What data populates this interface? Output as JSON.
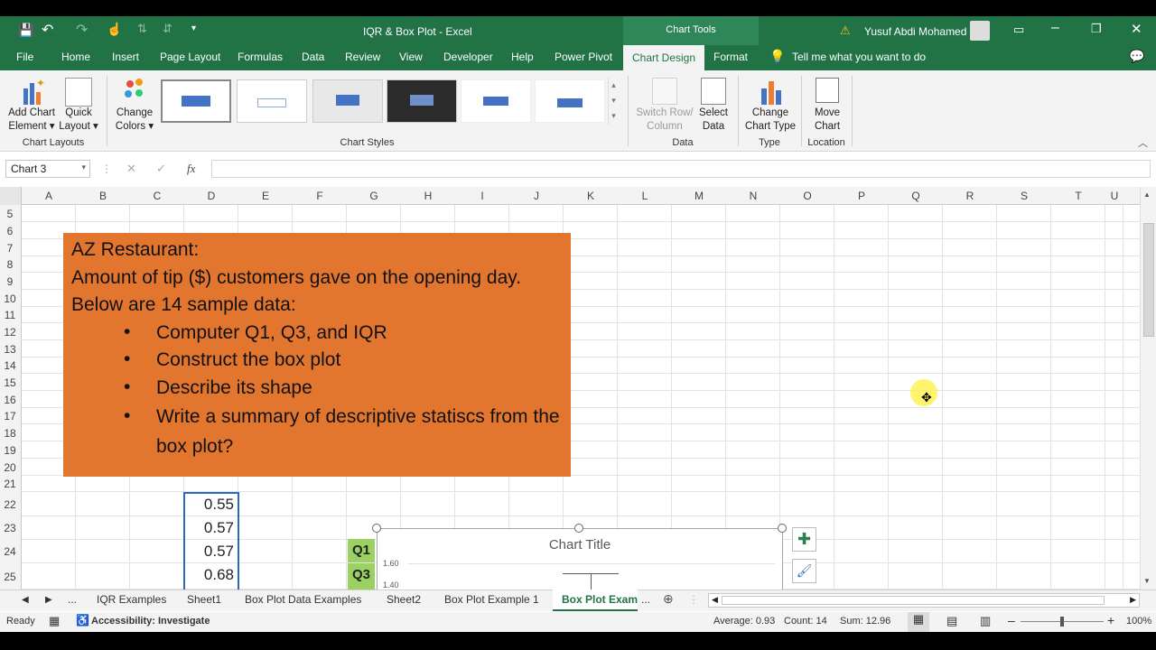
{
  "window": {
    "title": "IQR & Box Plot  -  Excel",
    "user": "Yusuf Abdi Mohamed",
    "chart_tools": "Chart Tools"
  },
  "tabs": [
    "File",
    "Home",
    "Insert",
    "Page Layout",
    "Formulas",
    "Data",
    "Review",
    "View",
    "Developer",
    "Help",
    "Power Pivot",
    "Chart Design",
    "Format"
  ],
  "tell_me": "Tell me what you want to do",
  "ribbon": {
    "add_chart_element": [
      "Add Chart",
      "Element"
    ],
    "quick_layout": [
      "Quick",
      "Layout"
    ],
    "chart_layouts": "Chart Layouts",
    "change_colors": [
      "Change",
      "Colors"
    ],
    "chart_styles": "Chart Styles",
    "switch_row_col": [
      "Switch Row/",
      "Column"
    ],
    "select_data": [
      "Select",
      "Data"
    ],
    "data_group": "Data",
    "change_chart_type": [
      "Change",
      "Chart Type"
    ],
    "type_group": "Type",
    "move_chart": [
      "Move",
      "Chart"
    ],
    "location_group": "Location"
  },
  "name_box": "Chart 3",
  "formula_buttons": {
    "cancel": "✕",
    "enter": "✓",
    "fx": "fx"
  },
  "columns": [
    "A",
    "B",
    "C",
    "D",
    "E",
    "F",
    "G",
    "H",
    "I",
    "J",
    "K",
    "L",
    "M",
    "N",
    "O",
    "P",
    "Q",
    "R",
    "S",
    "T",
    "U"
  ],
  "rows": [
    "5",
    "6",
    "7",
    "8",
    "9",
    "10",
    "11",
    "12",
    "13",
    "14",
    "15",
    "16",
    "17",
    "18",
    "19",
    "20",
    "21",
    "22",
    "23",
    "24",
    "25"
  ],
  "box": {
    "line1": "AZ Restaurant:",
    "line2": "Amount of tip ($) customers gave on the opening day.",
    "line3": "Below are 14 sample data:",
    "bullets": [
      "Computer Q1, Q3, and IQR",
      "Construct the box plot",
      "Describe its shape",
      "Write a summary of descriptive statiscs from the box plot?"
    ]
  },
  "data_values": [
    "0.55",
    "0.57",
    "0.57",
    "0.68"
  ],
  "labels": {
    "q1": "Q1",
    "q3": "Q3"
  },
  "chart": {
    "title": "Chart Title",
    "ticks": [
      "1.60",
      "1.40"
    ]
  },
  "sheets": [
    "IQR Examples",
    "Sheet1",
    "Box Plot Data Examples",
    "Sheet2",
    "Box Plot Example 1",
    "Box Plot Exam"
  ],
  "sheet_ellipsis": "...",
  "status": {
    "ready": "Ready",
    "accessibility": "Accessibility: Investigate",
    "average": "Average: 0.93",
    "count": "Count: 14",
    "sum": "Sum: 12.96",
    "zoom": "100%"
  }
}
